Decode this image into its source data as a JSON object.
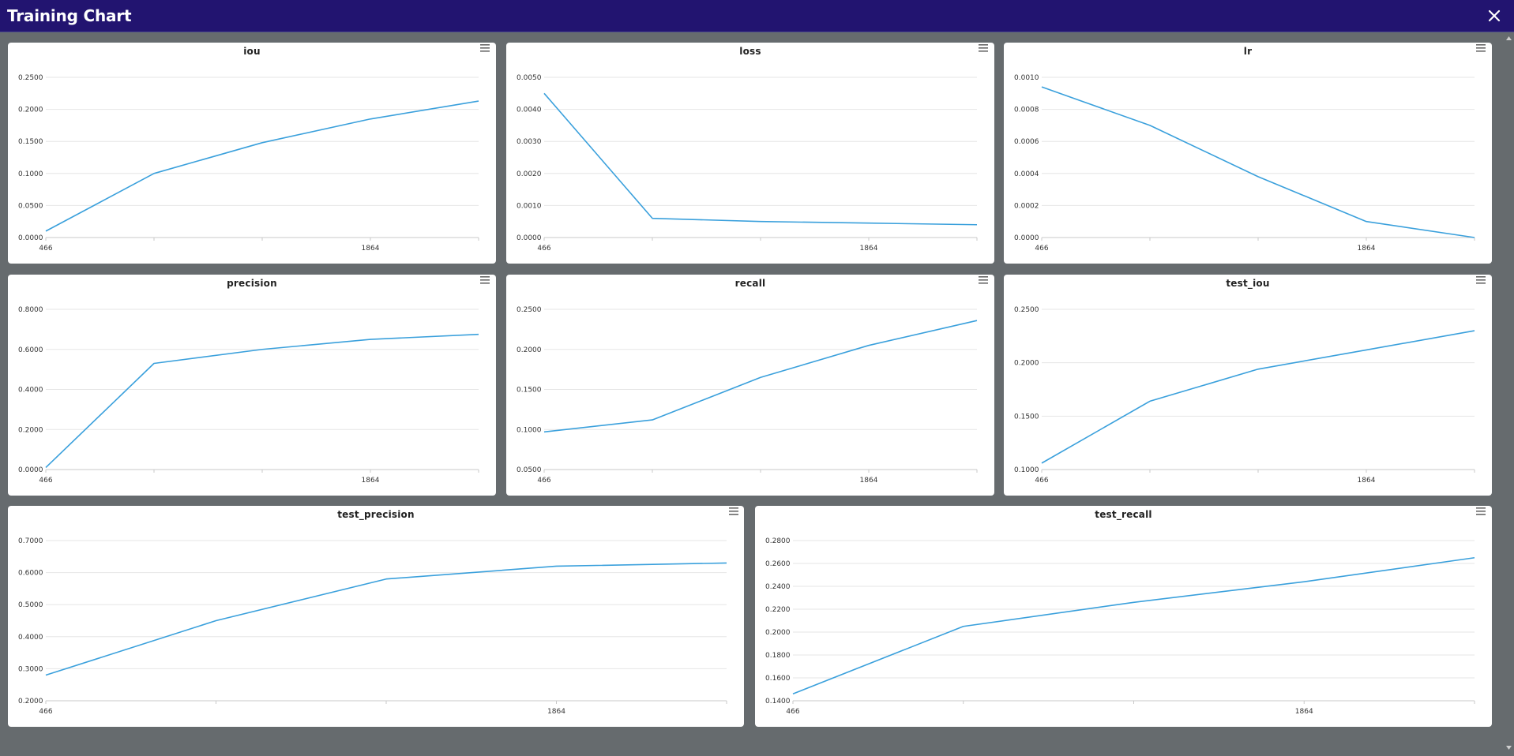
{
  "window": {
    "title": "Training Chart",
    "close_icon": "close-icon",
    "accent_color": "#221470",
    "line_color": "#3aa0dc"
  },
  "charts": [
    {
      "title": "iou",
      "chart_data": {
        "type": "line",
        "title": "iou",
        "x": [
          466,
          932,
          1398,
          1864,
          2330
        ],
        "x_tick_labels": [
          "466",
          "1864"
        ],
        "y": [
          0.01,
          0.1,
          0.148,
          0.185,
          0.213
        ],
        "y_ticks": [
          0,
          0.05,
          0.1,
          0.15,
          0.2,
          0.25
        ],
        "y_tick_labels": [
          "0.0000",
          "0.0500",
          "0.1000",
          "0.1500",
          "0.2000",
          "0.2500"
        ],
        "ylim": [
          0,
          0.25
        ],
        "grid": true
      }
    },
    {
      "title": "loss",
      "chart_data": {
        "type": "line",
        "title": "loss",
        "x": [
          466,
          932,
          1398,
          1864,
          2330
        ],
        "x_tick_labels": [
          "466",
          "1864"
        ],
        "y": [
          0.0045,
          0.0006,
          0.0005,
          0.00045,
          0.0004
        ],
        "y_ticks": [
          0,
          0.001,
          0.002,
          0.003,
          0.004,
          0.005
        ],
        "y_tick_labels": [
          "0.0000",
          "0.0010",
          "0.0020",
          "0.0030",
          "0.0040",
          "0.0050"
        ],
        "ylim": [
          0,
          0.005
        ],
        "grid": true
      }
    },
    {
      "title": "lr",
      "chart_data": {
        "type": "line",
        "title": "lr",
        "x": [
          466,
          932,
          1398,
          1864,
          2330
        ],
        "x_tick_labels": [
          "466",
          "1864"
        ],
        "y": [
          0.00094,
          0.0007,
          0.00038,
          0.0001,
          0.0
        ],
        "y_ticks": [
          0,
          0.0002,
          0.0004,
          0.0006,
          0.0008,
          0.001
        ],
        "y_tick_labels": [
          "0.0000",
          "0.0002",
          "0.0004",
          "0.0006",
          "0.0008",
          "0.0010"
        ],
        "ylim": [
          0,
          0.001
        ],
        "grid": true
      }
    },
    {
      "title": "precision",
      "chart_data": {
        "type": "line",
        "title": "precision",
        "x": [
          466,
          932,
          1398,
          1864,
          2330
        ],
        "x_tick_labels": [
          "466",
          "1864"
        ],
        "y": [
          0.01,
          0.53,
          0.6,
          0.65,
          0.675
        ],
        "y_ticks": [
          0,
          0.2,
          0.4,
          0.6,
          0.8
        ],
        "y_tick_labels": [
          "0.0000",
          "0.2000",
          "0.4000",
          "0.6000",
          "0.8000"
        ],
        "ylim": [
          0,
          0.8
        ],
        "grid": true
      }
    },
    {
      "title": "recall",
      "chart_data": {
        "type": "line",
        "title": "recall",
        "x": [
          466,
          932,
          1398,
          1864,
          2330
        ],
        "x_tick_labels": [
          "466",
          "1864"
        ],
        "y": [
          0.097,
          0.112,
          0.165,
          0.205,
          0.236
        ],
        "y_ticks": [
          0.05,
          0.1,
          0.15,
          0.2,
          0.25
        ],
        "y_tick_labels": [
          "0.0500",
          "0.1000",
          "0.1500",
          "0.2000",
          "0.2500"
        ],
        "ylim": [
          0.05,
          0.25
        ],
        "grid": true
      }
    },
    {
      "title": "test_iou",
      "chart_data": {
        "type": "line",
        "title": "test_iou",
        "x": [
          466,
          932,
          1398,
          1864,
          2330
        ],
        "x_tick_labels": [
          "466",
          "1864"
        ],
        "y": [
          0.106,
          0.164,
          0.194,
          0.212,
          0.23
        ],
        "y_ticks": [
          0.1,
          0.15,
          0.2,
          0.25
        ],
        "y_tick_labels": [
          "0.1000",
          "0.1500",
          "0.2000",
          "0.2500"
        ],
        "ylim": [
          0.1,
          0.25
        ],
        "grid": true
      }
    },
    {
      "title": "test_precision",
      "chart_data": {
        "type": "line",
        "title": "test_precision",
        "x": [
          466,
          932,
          1398,
          1864,
          2330
        ],
        "x_tick_labels": [
          "466",
          "1864"
        ],
        "y": [
          0.28,
          0.45,
          0.58,
          0.62,
          0.63
        ],
        "y_ticks": [
          0.2,
          0.3,
          0.4,
          0.5,
          0.6,
          0.7
        ],
        "y_tick_labels": [
          "0.2000",
          "0.3000",
          "0.4000",
          "0.5000",
          "0.6000",
          "0.7000"
        ],
        "ylim": [
          0.2,
          0.7
        ],
        "grid": true
      }
    },
    {
      "title": "test_recall",
      "chart_data": {
        "type": "line",
        "title": "test_recall",
        "x": [
          466,
          932,
          1398,
          1864,
          2330
        ],
        "x_tick_labels": [
          "466",
          "1864"
        ],
        "y": [
          0.146,
          0.205,
          0.226,
          0.244,
          0.265
        ],
        "y_ticks": [
          0.14,
          0.16,
          0.18,
          0.2,
          0.22,
          0.24,
          0.26,
          0.28
        ],
        "y_tick_labels": [
          "0.1400",
          "0.1600",
          "0.1800",
          "0.2000",
          "0.2200",
          "0.2400",
          "0.2600",
          "0.2800"
        ],
        "ylim": [
          0.14,
          0.28
        ],
        "grid": true
      }
    }
  ]
}
